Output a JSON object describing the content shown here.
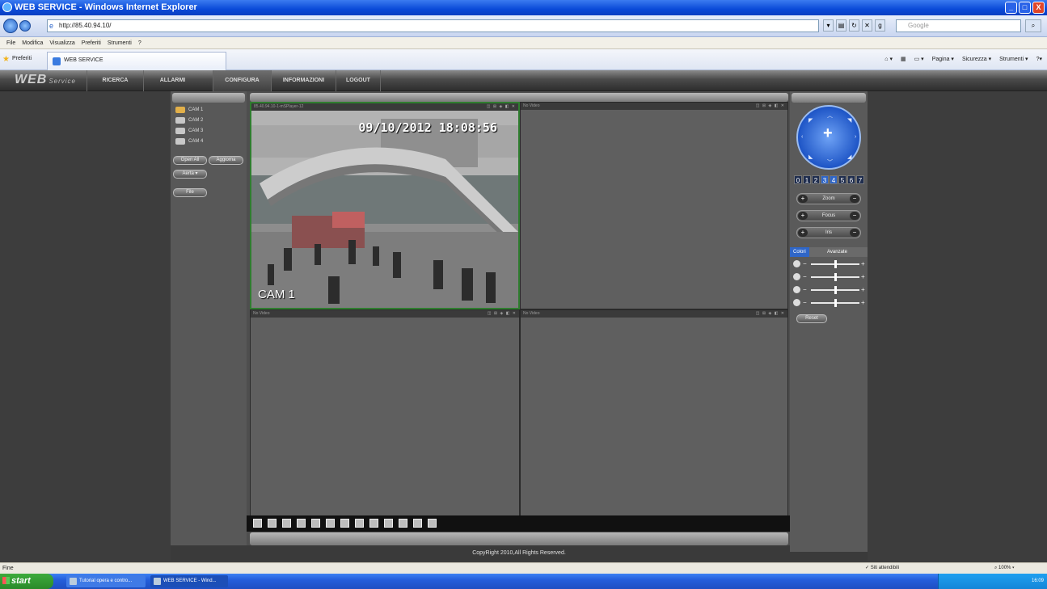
{
  "window": {
    "title": "WEB SERVICE - Windows Internet Explorer",
    "buttons": [
      "_",
      "□",
      "X"
    ]
  },
  "browser": {
    "url": "http://85.40.94.10/",
    "search_placeholder": "Google",
    "menu": [
      "File",
      "Modifica",
      "Visualizza",
      "Preferiti",
      "Strumenti",
      "?"
    ],
    "favorites_label": "Preferiti",
    "tab_label": "WEB SERVICE",
    "command_bar": [
      "Pagina ▾",
      "Sicurezza ▾",
      "Strumenti ▾"
    ]
  },
  "app": {
    "logo": "WEB",
    "logo_sub": "Service",
    "nav": [
      "RICERCA",
      "ALLARMI",
      "CONFIGURA",
      "INFORMAZIONI",
      "LOGOUT"
    ],
    "active_nav": "CONFIGURA"
  },
  "sidebar": {
    "cameras": [
      {
        "label": "CAM 1",
        "active": true
      },
      {
        "label": "CAM 2",
        "active": false
      },
      {
        "label": "CAM 3",
        "active": false
      },
      {
        "label": "CAM 4",
        "active": false
      }
    ],
    "open_all": "Open All",
    "refresh": "Aggiorna",
    "open": "Aerta",
    "file": "File"
  },
  "video": {
    "cells": [
      {
        "header": "85.40.94.10-1-mSPlayer-12",
        "selected": true
      },
      {
        "header": "No Video",
        "selected": false
      },
      {
        "header": "No Video",
        "selected": false
      },
      {
        "header": "No Video",
        "selected": false
      }
    ],
    "cell_controls": "◫ ⊞ ◈ ◧ ✕",
    "osd_datetime": "09/10/2012 18:08:56",
    "osd_camera": "CAM 1",
    "toolbar_count": 13
  },
  "footer": {
    "copyright": "CopyRight 2010,All Rights Reserved."
  },
  "ptz": {
    "speeds": [
      "0",
      "1",
      "2",
      "3",
      "4",
      "5",
      "6",
      "7"
    ],
    "active_speeds": [
      3,
      4
    ],
    "zoom": "Zoom",
    "focus": "Focus",
    "iris": "Iris",
    "tab_color": "Colori",
    "tab_advanced": "Avanzate",
    "slider_levels": [
      0.5,
      0.5,
      0.5,
      0.5
    ],
    "reset": "Reset"
  },
  "status": {
    "left": "Fine",
    "zone": "Siti attendibili",
    "zoom": "100%"
  },
  "taskbar": {
    "start": "start",
    "tasks": [
      "Tutorial opera e contro...",
      "WEB SERVICE - Wind..."
    ],
    "clock": "16:09"
  },
  "colors": {
    "title_blue": "#0a4ad8",
    "selected_cell": "#2f7d2f",
    "ptz_blue": "#1e55c6"
  }
}
